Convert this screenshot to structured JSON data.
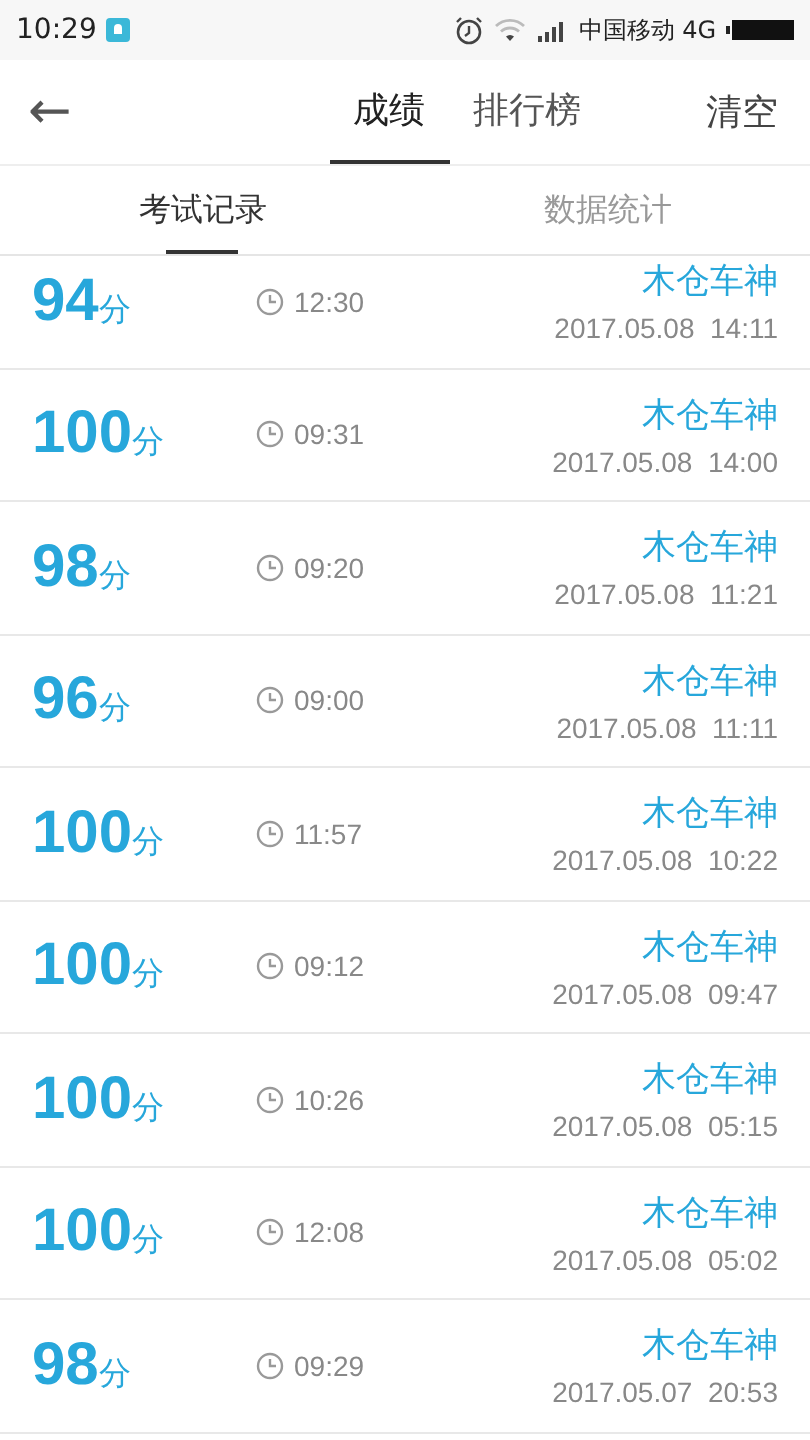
{
  "status_bar": {
    "time": "10:29",
    "carrier": "中国移动 4G"
  },
  "header": {
    "back": "←",
    "tabs": [
      {
        "label": "成绩",
        "selected": true
      },
      {
        "label": "排行榜",
        "selected": false
      }
    ],
    "action": "清空"
  },
  "subtabs": [
    {
      "label": "考试记录",
      "selected": true
    },
    {
      "label": "数据统计",
      "selected": false
    }
  ],
  "records": [
    {
      "score": "94",
      "unit": "分",
      "duration": "12:30",
      "name": "木仓车神",
      "date": "2017.05.08  14:11"
    },
    {
      "score": "100",
      "unit": "分",
      "duration": "09:31",
      "name": "木仓车神",
      "date": "2017.05.08  14:00"
    },
    {
      "score": "98",
      "unit": "分",
      "duration": "09:20",
      "name": "木仓车神",
      "date": "2017.05.08  11:21"
    },
    {
      "score": "96",
      "unit": "分",
      "duration": "09:00",
      "name": "木仓车神",
      "date": "2017.05.08  11:11"
    },
    {
      "score": "100",
      "unit": "分",
      "duration": "11:57",
      "name": "木仓车神",
      "date": "2017.05.08  10:22"
    },
    {
      "score": "100",
      "unit": "分",
      "duration": "09:12",
      "name": "木仓车神",
      "date": "2017.05.08  09:47"
    },
    {
      "score": "100",
      "unit": "分",
      "duration": "10:26",
      "name": "木仓车神",
      "date": "2017.05.08  05:15"
    },
    {
      "score": "100",
      "unit": "分",
      "duration": "12:08",
      "name": "木仓车神",
      "date": "2017.05.08  05:02"
    },
    {
      "score": "98",
      "unit": "分",
      "duration": "09:29",
      "name": "木仓车神",
      "date": "2017.05.07  20:53"
    }
  ]
}
